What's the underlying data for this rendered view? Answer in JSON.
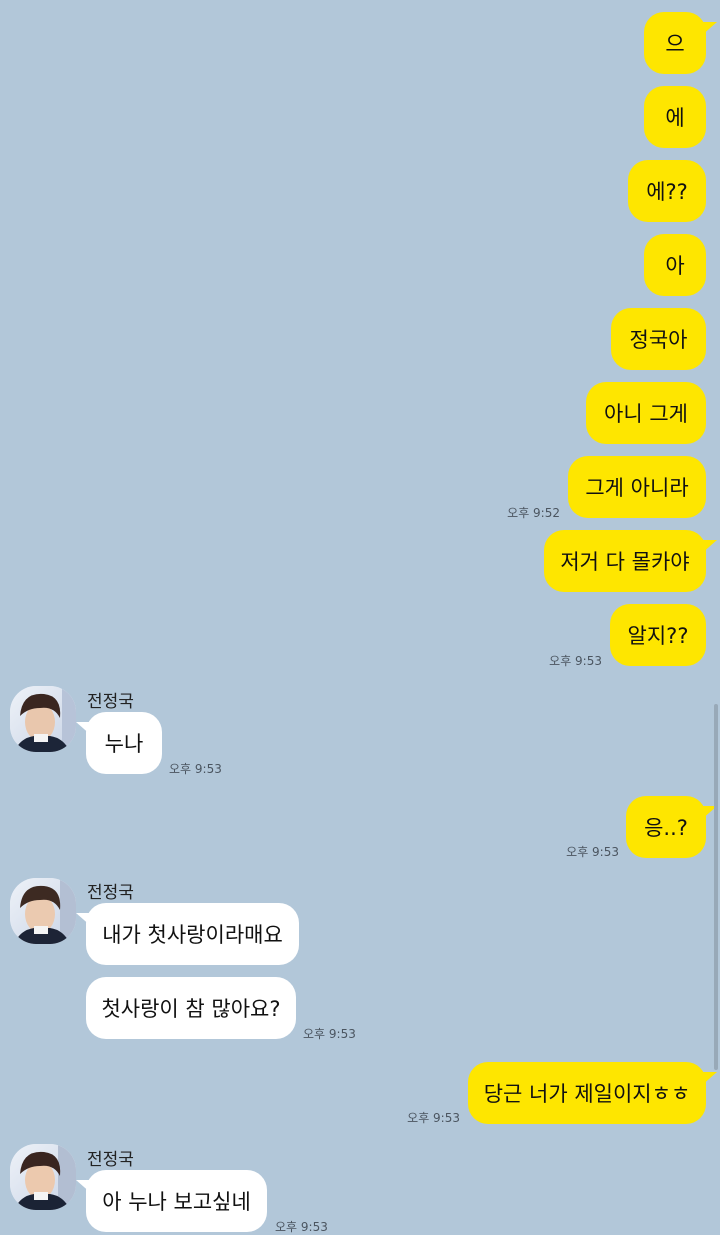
{
  "chat": {
    "contact_name": "전정국",
    "messages": [
      {
        "sender": "me",
        "text": "으"
      },
      {
        "sender": "me",
        "text": "에"
      },
      {
        "sender": "me",
        "text": "에??"
      },
      {
        "sender": "me",
        "text": "아"
      },
      {
        "sender": "me",
        "text": "정국아"
      },
      {
        "sender": "me",
        "text": "아니 그게"
      },
      {
        "sender": "me",
        "text": "그게 아니라",
        "time": "오후 9:52"
      },
      {
        "sender": "me",
        "text": "저거 다 몰카야"
      },
      {
        "sender": "me",
        "text": "알지??",
        "time": "오후 9:53"
      },
      {
        "sender": "전정국",
        "text": "누나",
        "time": "오후 9:53"
      },
      {
        "sender": "me",
        "text": "응..?",
        "time": "오후 9:53"
      },
      {
        "sender": "전정국",
        "text": "내가 첫사랑이라매요"
      },
      {
        "sender": "전정국",
        "text": "첫사랑이 참 많아요?",
        "time": "오후 9:53"
      },
      {
        "sender": "me",
        "text": "당근 너가 제일이지ㅎㅎ",
        "time": "오후 9:53"
      },
      {
        "sender": "전정국",
        "text": "아 누나 보고싶네",
        "time": "오후 9:53"
      }
    ]
  },
  "colors": {
    "background": "#b2c7d9",
    "my_bubble": "#fee600",
    "their_bubble": "#ffffff"
  },
  "icons": {
    "avatar": "profile-photo"
  }
}
